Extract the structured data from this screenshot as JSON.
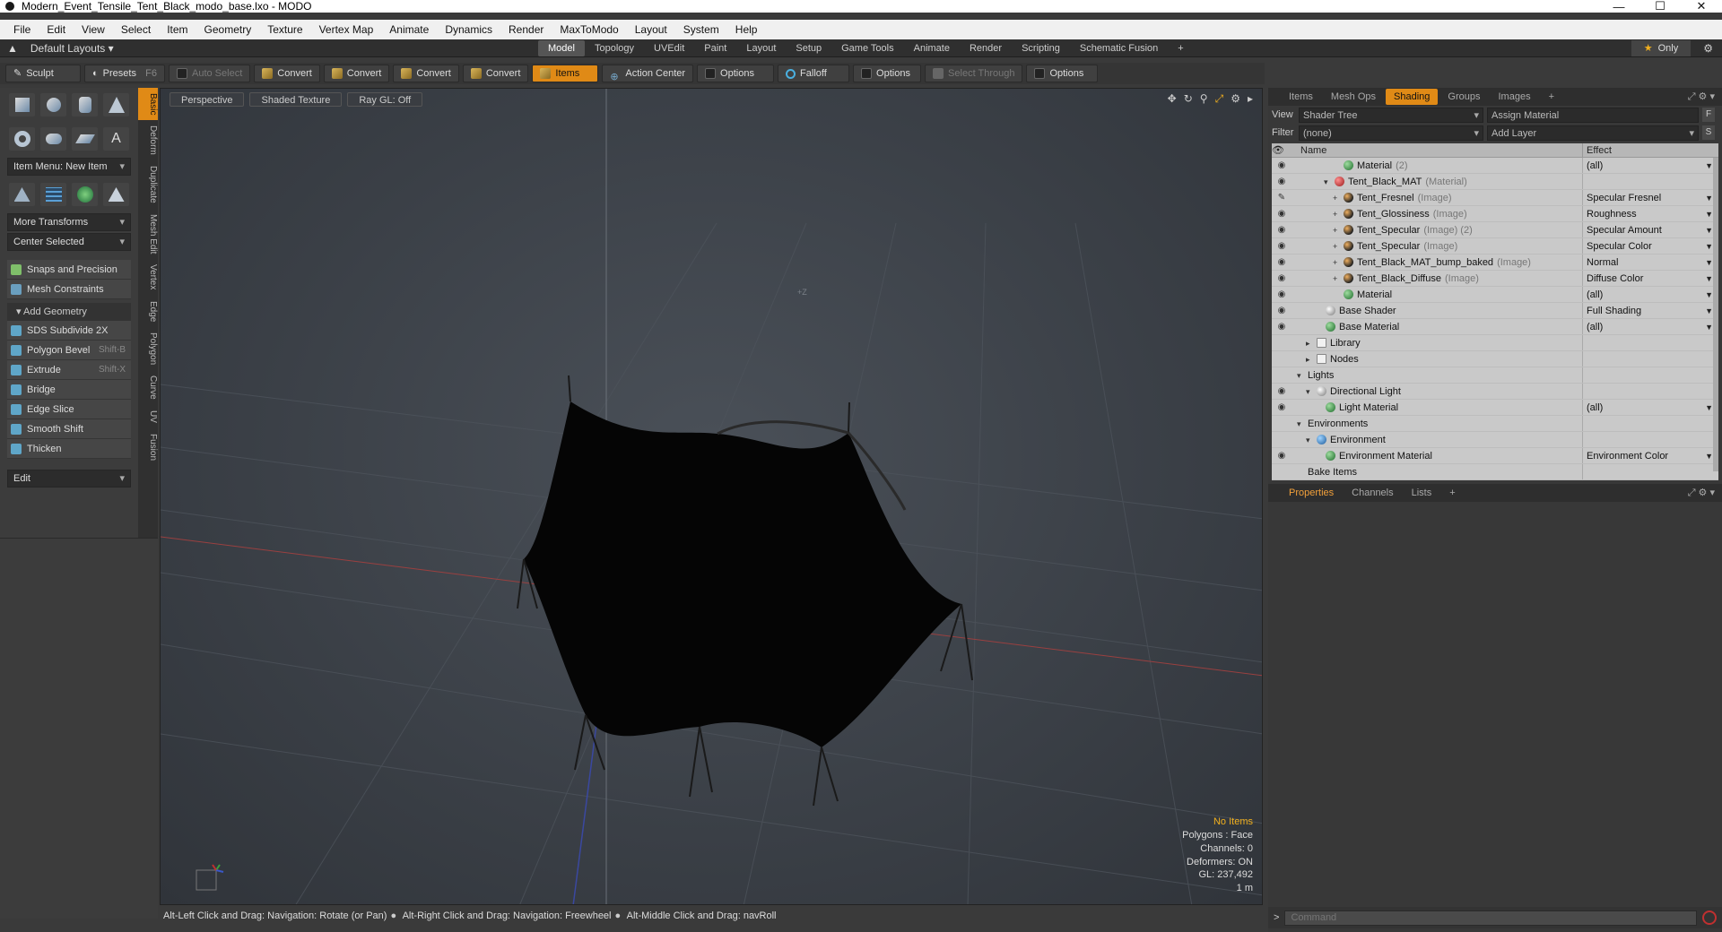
{
  "window": {
    "title": "Modern_Event_Tensile_Tent_Black_modo_base.lxo - MODO",
    "minimize": "—",
    "maximize": "☐",
    "close": "✕"
  },
  "menu": [
    "File",
    "Edit",
    "View",
    "Select",
    "Item",
    "Geometry",
    "Texture",
    "Vertex Map",
    "Animate",
    "Dynamics",
    "Render",
    "MaxToModo",
    "Layout",
    "System",
    "Help"
  ],
  "layout_row": {
    "layouts_label": "Default Layouts",
    "tabs": [
      "Model",
      "Topology",
      "UVEdit",
      "Paint",
      "Layout",
      "Setup",
      "Game Tools",
      "Animate",
      "Render",
      "Scripting",
      "Schematic Fusion"
    ],
    "active_tab": "Model",
    "add": "+",
    "only": "Only"
  },
  "toolbar": {
    "sculpt": "Sculpt",
    "presets": "Presets",
    "presets_key": "F6",
    "auto_select": "Auto Select",
    "convert": "Convert",
    "items": "Items",
    "action_center": "Action Center",
    "options": "Options",
    "falloff": "Falloff",
    "select_through": "Select Through"
  },
  "left": {
    "item_menu": "Item Menu: New Item",
    "more_transforms": "More Transforms",
    "center_selected": "Center Selected",
    "snaps": "Snaps and Precision",
    "mesh_constraints": "Mesh Constraints",
    "add_geometry": "Add Geometry",
    "tools": [
      {
        "label": "SDS Subdivide 2X",
        "key": ""
      },
      {
        "label": "Polygon Bevel",
        "key": "Shift-B"
      },
      {
        "label": "Extrude",
        "key": "Shift-X"
      },
      {
        "label": "Bridge",
        "key": ""
      },
      {
        "label": "Edge Slice",
        "key": ""
      },
      {
        "label": "Smooth Shift",
        "key": ""
      },
      {
        "label": "Thicken",
        "key": ""
      }
    ],
    "edit": "Edit",
    "side_tabs": [
      "Basic",
      "Deform",
      "Duplicate",
      "Mesh Edit",
      "Vertex",
      "Edge",
      "Polygon",
      "Curve",
      "UV",
      "Fusion"
    ]
  },
  "viewport": {
    "perspective": "Perspective",
    "shaded": "Shaded Texture",
    "raygl": "Ray GL: Off",
    "axis_label": "+Z",
    "stats": {
      "items": "No Items",
      "polygons": "Polygons : Face",
      "channels": "Channels: 0",
      "deformers": "Deformers: ON",
      "gl": "GL: 237,492",
      "scale": "1 m"
    }
  },
  "status": {
    "hint1": "Alt-Left Click and Drag: Navigation: Rotate (or Pan)",
    "hint2": "Alt-Right Click and Drag: Navigation: Freewheel",
    "hint3": "Alt-Middle Click and Drag: navRoll"
  },
  "right": {
    "tabs": [
      "Items",
      "Mesh Ops",
      "Shading",
      "Groups",
      "Images"
    ],
    "active_tab": "Shading",
    "view_label": "View",
    "view_value": "Shader Tree",
    "assign_material": "Assign Material",
    "filter_label": "Filter",
    "filter_value": "(none)",
    "add_layer": "Add Layer",
    "btn_f": "F",
    "btn_s": "S",
    "col_name": "Name",
    "col_effect": "Effect",
    "rows": [
      {
        "name": "Material",
        "type": "(2)",
        "effect": "(all)",
        "indent": 4,
        "ball": "green",
        "eye": true
      },
      {
        "name": "Tent_Black_MAT",
        "type": "(Material)",
        "effect": "",
        "indent": 3,
        "ball": "red",
        "eye": true,
        "twist": "▾"
      },
      {
        "name": "Tent_Fresnel",
        "type": "(Image)",
        "effect": "Specular Fresnel",
        "indent": 4,
        "ball": "img",
        "eye": "brush",
        "twist": "+"
      },
      {
        "name": "Tent_Glossiness",
        "type": "(Image)",
        "effect": "Roughness",
        "indent": 4,
        "ball": "img",
        "eye": true,
        "twist": "+"
      },
      {
        "name": "Tent_Specular",
        "type": "(Image) (2)",
        "effect": "Specular Amount",
        "indent": 4,
        "ball": "img",
        "eye": true,
        "twist": "+"
      },
      {
        "name": "Tent_Specular",
        "type": "(Image)",
        "effect": "Specular Color",
        "indent": 4,
        "ball": "img",
        "eye": true,
        "twist": "+"
      },
      {
        "name": "Tent_Black_MAT_bump_baked",
        "type": "(Image)",
        "effect": "Normal",
        "indent": 4,
        "ball": "img",
        "eye": true,
        "twist": "+"
      },
      {
        "name": "Tent_Black_Diffuse",
        "type": "(Image)",
        "effect": "Diffuse Color",
        "indent": 4,
        "ball": "img",
        "eye": true,
        "twist": "+"
      },
      {
        "name": "Material",
        "type": "",
        "effect": "(all)",
        "indent": 4,
        "ball": "green",
        "eye": true
      },
      {
        "name": "Base Shader",
        "type": "",
        "effect": "Full Shading",
        "indent": 2,
        "ball": "white",
        "eye": true
      },
      {
        "name": "Base Material",
        "type": "",
        "effect": "(all)",
        "indent": 2,
        "ball": "green",
        "eye": true
      },
      {
        "name": "Library",
        "type": "",
        "effect": "",
        "indent": 1,
        "ball": "folder",
        "eye": false,
        "twist": "▸"
      },
      {
        "name": "Nodes",
        "type": "",
        "effect": "",
        "indent": 1,
        "ball": "folder",
        "eye": false,
        "twist": "▸"
      },
      {
        "name": "Lights",
        "type": "",
        "effect": "",
        "indent": 0,
        "ball": "",
        "eye": false,
        "twist": "▾"
      },
      {
        "name": "Directional Light",
        "type": "",
        "effect": "",
        "indent": 1,
        "ball": "white",
        "eye": true,
        "twist": "▾"
      },
      {
        "name": "Light Material",
        "type": "",
        "effect": "(all)",
        "indent": 2,
        "ball": "green",
        "eye": true
      },
      {
        "name": "Environments",
        "type": "",
        "effect": "",
        "indent": 0,
        "ball": "",
        "eye": false,
        "twist": "▾"
      },
      {
        "name": "Environment",
        "type": "",
        "effect": "",
        "indent": 1,
        "ball": "blue",
        "eye": false,
        "twist": "▾"
      },
      {
        "name": "Environment Material",
        "type": "",
        "effect": "Environment Color",
        "indent": 2,
        "ball": "green",
        "eye": true
      },
      {
        "name": "Bake Items",
        "type": "",
        "effect": "",
        "indent": 0,
        "ball": "",
        "eye": false
      }
    ],
    "prop_tabs": [
      "Properties",
      "Channels",
      "Lists"
    ],
    "prop_active": "Properties",
    "command_prompt": ">",
    "command_placeholder": "Command"
  },
  "colors": {
    "accent": "#e08a16",
    "highlight_text": "#f2b01e",
    "viewport_bg": "#3c4148"
  }
}
